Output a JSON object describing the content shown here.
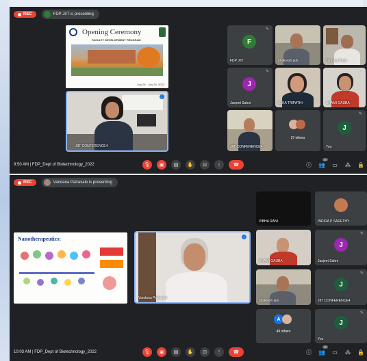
{
  "meeting1": {
    "rec_label": "REC",
    "presenter_text": "FDP JIIT is presenting",
    "slide": {
      "title": "Opening Ceremony",
      "subtitle": "FACULTY DEVELOPMENT PROGRAM",
      "dates": "July 26 - July 30, 2022"
    },
    "participants": [
      {
        "name": "FDP JIIT",
        "initial": "F",
        "color": "#2e7d32"
      },
      {
        "name": "chakresh jain",
        "initial": "",
        "color": ""
      },
      {
        "name": "Tanmoy Basu",
        "initial": "",
        "color": ""
      },
      {
        "name": "Jasjeet Sahni",
        "initial": "J",
        "color": "#9c27b0"
      },
      {
        "name": "ALKA TRIPATHI",
        "initial": "",
        "color": ""
      },
      {
        "name": "SHAMI GAUBA",
        "initial": "",
        "color": ""
      },
      {
        "name": "JIIT CONFERENCE4",
        "initial": "",
        "color": ""
      },
      {
        "name": "37 others",
        "initial": "",
        "color": ""
      },
      {
        "name": "You",
        "initial": "J",
        "color": "#1e5e3b"
      }
    ],
    "featured_name": "JIIT CONFERENCE4",
    "time": "9:50 AM",
    "meeting_code": "FDP_Dept of Biotechnology_2022",
    "people_count": "47"
  },
  "meeting2": {
    "rec_label": "REC",
    "presenter_text": "Vandana Patravale is presenting",
    "slide_title": "Nanotherapeutics:",
    "featured_name": "Vandana Patravale",
    "participants": [
      {
        "name": "VIBHA RANI",
        "initial": "",
        "color": ""
      },
      {
        "name": "INDIRA P SARETHY",
        "initial": "",
        "color": ""
      },
      {
        "name": "SHAMI GAUBA",
        "initial": "",
        "color": ""
      },
      {
        "name": "Jasjeet Sahni",
        "initial": "J",
        "color": "#9c27b0"
      },
      {
        "name": "chakresh jain",
        "initial": "",
        "color": ""
      },
      {
        "name": "JIIT CONFERENCE4",
        "initial": "J",
        "color": "#1e5e3b"
      },
      {
        "name": "49 others",
        "initial": "A",
        "color": "#1a73e8"
      },
      {
        "name": "You",
        "initial": "J",
        "color": "#1e5e3b"
      }
    ],
    "time": "10:03 AM",
    "meeting_code": "FDP_Dept of Biotechnology_2022",
    "people_count": "49"
  },
  "separator": "|",
  "icons": {
    "mic": "mic-off-icon",
    "cam": "camera-off-icon",
    "cc": "captions-icon",
    "hand": "raise-hand-icon",
    "present": "present-screen-icon",
    "more": "more-options-icon",
    "hangup": "hang-up-icon",
    "info": "info-icon",
    "people": "people-icon",
    "chat": "chat-icon",
    "activities": "activities-icon",
    "lock": "host-controls-icon"
  }
}
